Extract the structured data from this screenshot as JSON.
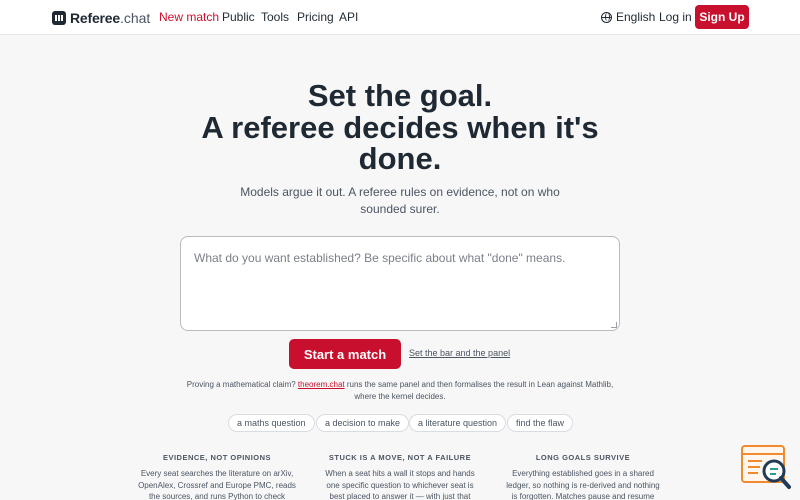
{
  "header": {
    "brand": "Referee",
    "brand_suffix": ".chat",
    "nav": [
      "New match",
      "Public",
      "Tools",
      "Pricing",
      "API"
    ],
    "language": "English",
    "login": "Log in",
    "signup": "Sign Up"
  },
  "hero": {
    "headline_1": "Set the goal.",
    "headline_2": "A referee decides when it's",
    "headline_3": "done.",
    "sub_1": "Models argue it out. A referee rules on evidence, not on who",
    "sub_2": "sounded surer."
  },
  "prompt": {
    "placeholder": "What do you want established? Be specific about what \"done\" means."
  },
  "actions": {
    "start": "Start a match",
    "set_bar": "Set the bar and the panel"
  },
  "note": {
    "before": "Proving a mathematical claim? ",
    "link": "theorem.chat",
    "after": " runs the same panel and then formalises the result in Lean against Mathlib, where the kernel decides."
  },
  "chips": [
    "a maths question",
    "a decision to make",
    "a literature question",
    "find the flaw"
  ],
  "features": [
    {
      "title": "EVIDENCE, NOT OPINIONS",
      "body_1": "Every seat searches the literature on arXiv,",
      "body_2": "OpenAlex, Crossref and Europe PMC, reads",
      "body_3": "the sources, and runs Python to check"
    },
    {
      "title": "STUCK IS A MOVE, NOT A FAILURE",
      "body_1": "When a seat hits a wall it stops and hands",
      "body_2": "one specific question to whichever seat is",
      "body_3": "best placed to answer it — with just that"
    },
    {
      "title": "LONG GOALS SURVIVE",
      "body_1": "Everything established goes in a shared",
      "body_2": "ledger, so nothing is re-derived and nothing",
      "body_3": "is forgotten. Matches pause and resume"
    }
  ],
  "colors": {
    "accent": "#c8102e",
    "text": "#1f2933",
    "muted": "#4b5563",
    "background": "#f7f7f7"
  },
  "icons": {
    "logo": "referee-logo-icon",
    "language": "globe-icon",
    "widget": "search-chat-widget-icon"
  }
}
